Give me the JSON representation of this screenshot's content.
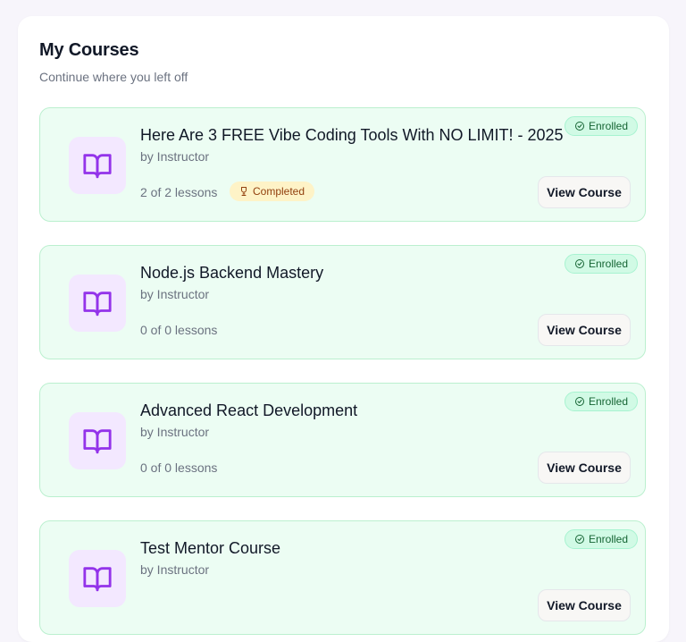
{
  "header": {
    "title": "My Courses",
    "subtitle": "Continue where you left off"
  },
  "courses": [
    {
      "title": "Here Are 3 FREE Vibe Coding Tools With NO LIMIT! - 2025",
      "author": "by Instructor",
      "lessons": "2 of 2 lessons",
      "completed_label": "Completed",
      "enrolled_label": "Enrolled",
      "button_label": "View Course"
    },
    {
      "title": "Node.js Backend Mastery",
      "author": "by Instructor",
      "lessons": "0 of 0 lessons",
      "enrolled_label": "Enrolled",
      "button_label": "View Course"
    },
    {
      "title": "Advanced React Development",
      "author": "by Instructor",
      "lessons": "0 of 0 lessons",
      "enrolled_label": "Enrolled",
      "button_label": "View Course"
    },
    {
      "title": "Test Mentor Course",
      "author": "by Instructor",
      "lessons": "",
      "enrolled_label": "Enrolled",
      "button_label": "View Course"
    }
  ],
  "icons": {
    "course_thumb": "book-open-icon",
    "enrolled": "check-circle-icon",
    "completed": "trophy-icon"
  },
  "colors": {
    "accent": "#9333ea",
    "card_bg": "#ecfdf3",
    "enrolled_text": "#166534",
    "completed_bg": "#fef3c7"
  }
}
